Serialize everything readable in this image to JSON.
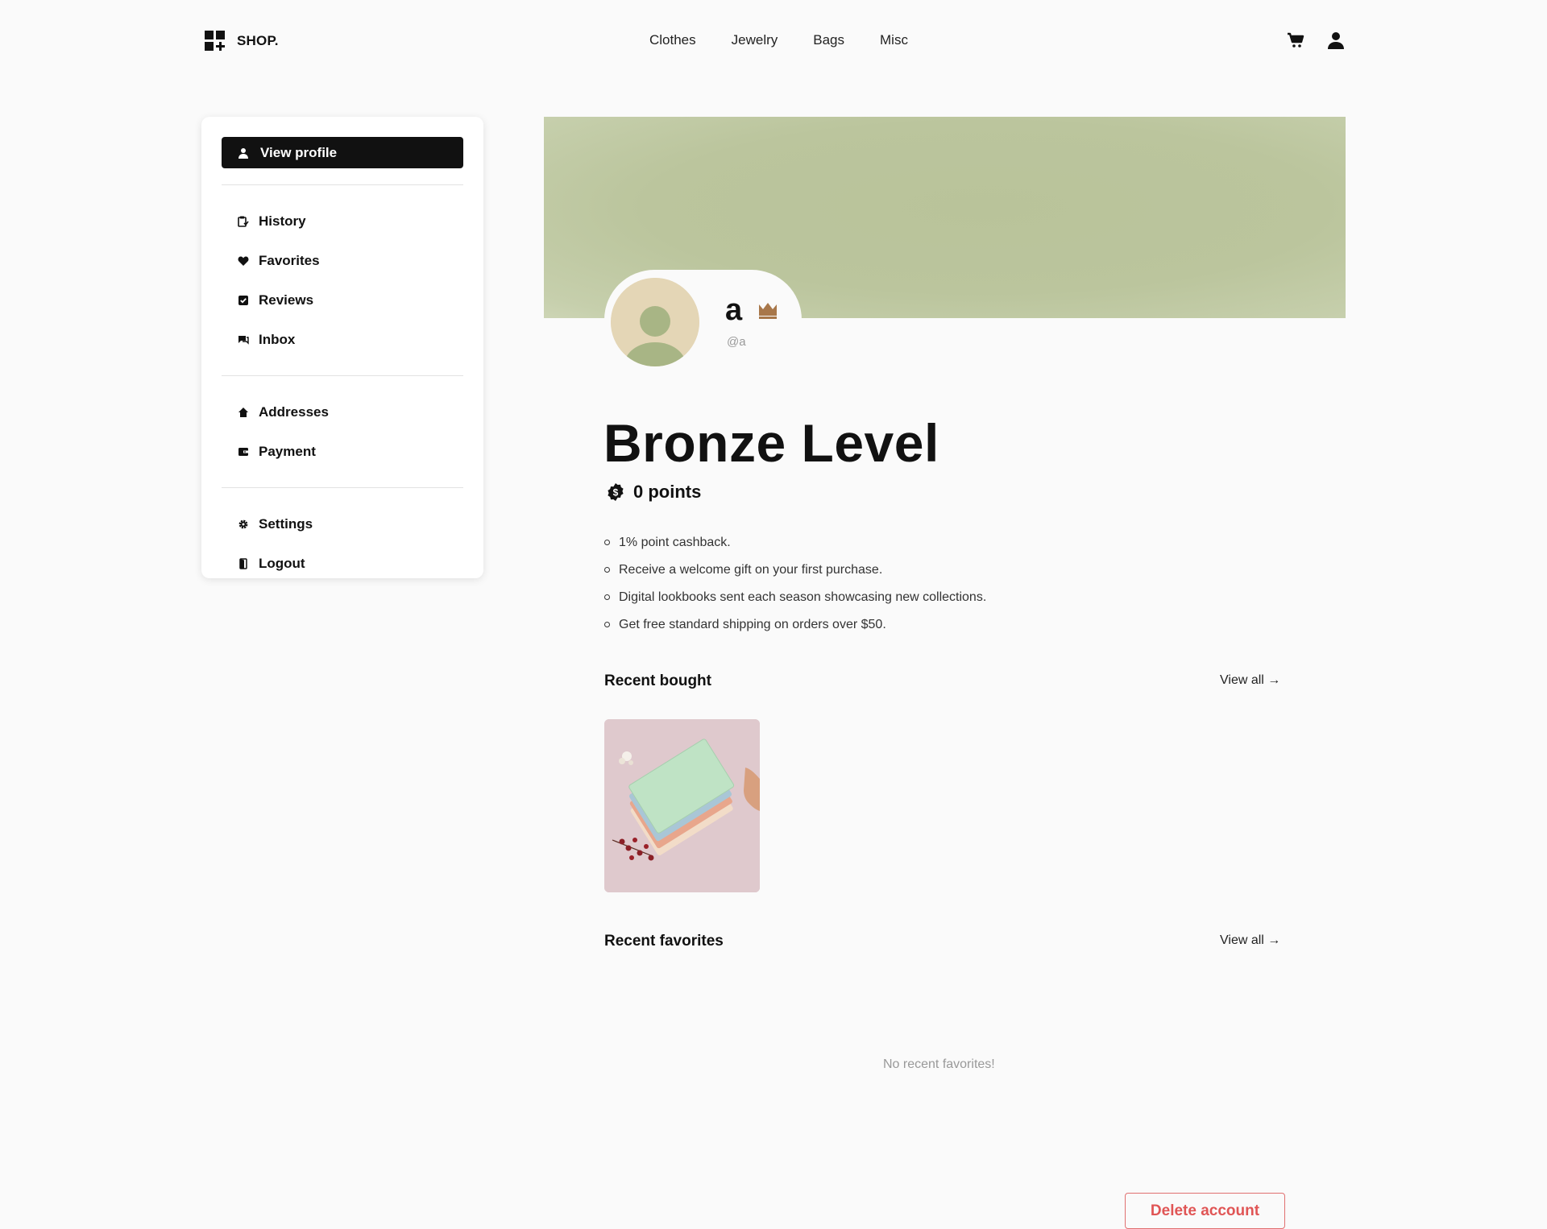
{
  "header": {
    "logo_text": "SHOP.",
    "nav": [
      "Clothes",
      "Jewelry",
      "Bags",
      "Misc"
    ],
    "icons": [
      "cart-icon",
      "user-icon"
    ]
  },
  "sidebar": {
    "view_profile_label": "View profile",
    "group1": [
      {
        "label": "History",
        "icon": "history-icon"
      },
      {
        "label": "Favorites",
        "icon": "heart-icon"
      },
      {
        "label": "Reviews",
        "icon": "check-square-icon"
      },
      {
        "label": "Inbox",
        "icon": "chat-icon"
      }
    ],
    "group2": [
      {
        "label": "Addresses",
        "icon": "home-icon"
      },
      {
        "label": "Payment",
        "icon": "wallet-icon"
      }
    ],
    "group3": [
      {
        "label": "Settings",
        "icon": "gear-icon"
      },
      {
        "label": "Logout",
        "icon": "door-icon"
      }
    ]
  },
  "profile": {
    "name": "a",
    "handle": "@a",
    "badge_icon": "crown-icon",
    "banner_color": "#bbc59d"
  },
  "level": {
    "title": "Bronze Level",
    "points_label": "0 points",
    "benefits": [
      "1% point cashback.",
      "Receive a welcome gift on your first purchase.",
      "Digital lookbooks sent each season showcasing new collections.",
      "Get free standard shipping on orders over $50."
    ]
  },
  "recent_bought": {
    "title": "Recent bought",
    "view_all": "View all →",
    "items": [
      {
        "image": "notebooks-photo"
      }
    ]
  },
  "recent_favorites": {
    "title": "Recent favorites",
    "view_all": "View all →",
    "empty_text": "No recent favorites!"
  },
  "delete_label": "Delete account",
  "colors": {
    "accent": "#111111",
    "danger": "#e05555",
    "crown": "#a8774a"
  }
}
